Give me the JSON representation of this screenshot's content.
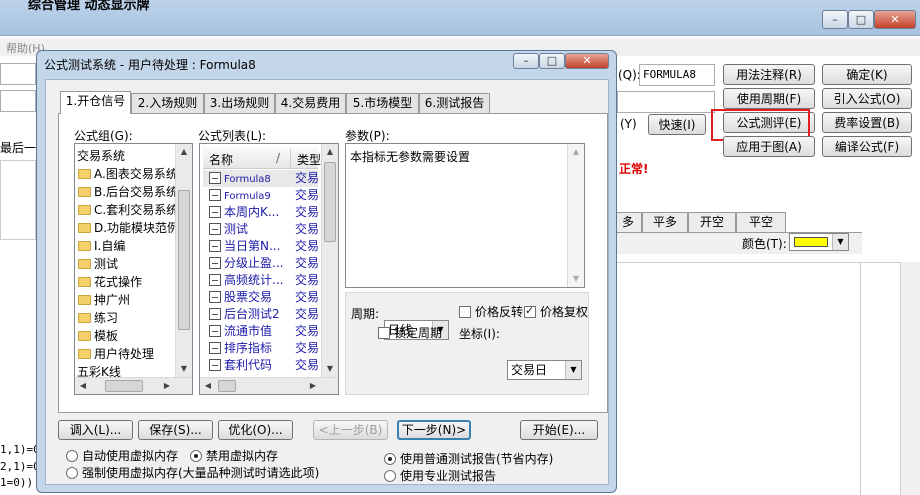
{
  "background": {
    "title": "综合管理 动态显示牌",
    "menu": "帮助(H)",
    "window_controls": {
      "minimize": "–",
      "maximize": "□",
      "close": "✕"
    },
    "formula_name_label": "(Q):",
    "formula_name_value": "FORMULA8",
    "buttons": {
      "usage_notes": "用法注释(R)",
      "confirm": "确定(K)",
      "usage_period": "使用周期(F)",
      "import_formula": "引入公式(O)",
      "quick": "快速(I)",
      "formula_test": "公式测评(E)",
      "fee_setting": "费率设置(B)",
      "apply_to_chart": "应用于图(A)",
      "edit_formula": "编译公式(F)"
    },
    "y_label": "(Y)",
    "status_text": "正常!",
    "left_text": "最后一根",
    "bottom_code": [
      "1,1)=0",
      "2,1)=0",
      "1=0))"
    ],
    "signal_tabs": [
      "多",
      "平多",
      "开空",
      "平空"
    ],
    "color_label": "颜色(T):",
    "color_value": "#ffff00"
  },
  "dialog": {
    "title": "公式测试系统 - 用户待处理 : Formula8",
    "tabs": [
      "1.开仓信号",
      "2.入场规则",
      "3.出场规则",
      "4.交易费用",
      "5.市场模型",
      "6.测试报告"
    ],
    "group_label": "公式组(G):",
    "groups": [
      "交易系统",
      "A.图表交易系统",
      "B.后台交易系统",
      "C.套利交易系统",
      "D.功能模块范例",
      "I.自编",
      "测试",
      "花式操作",
      "抻广州",
      "练习",
      "模板",
      "用户待处理",
      "五彩K线"
    ],
    "list_label": "公式列表(L):",
    "list_columns": [
      "名称",
      "/",
      "类型"
    ],
    "formulas": [
      {
        "name": "Formula8",
        "type": "交易"
      },
      {
        "name": "Formula9",
        "type": "交易"
      },
      {
        "name": "本周内K...",
        "type": "交易"
      },
      {
        "name": "测试",
        "type": "交易"
      },
      {
        "name": "当日第N...",
        "type": "交易"
      },
      {
        "name": "分级止盈...",
        "type": "交易"
      },
      {
        "name": "高频统计...",
        "type": "交易"
      },
      {
        "name": "股票交易",
        "type": "交易"
      },
      {
        "name": "后台测试2",
        "type": "交易"
      },
      {
        "name": "流通市值",
        "type": "交易"
      },
      {
        "name": "排序指标",
        "type": "交易"
      },
      {
        "name": "套利代码",
        "type": "交易"
      }
    ],
    "params_label": "参数(P):",
    "params_text": "本指标无参数需要设置",
    "period_label": "周期:",
    "period_value": "日线",
    "lock_period": "锁定周期",
    "price_invert": "价格反转",
    "price_restore": "价格复权",
    "axis_label": "坐标(I):",
    "axis_value": "交易日",
    "buttons": {
      "load": "调入(L)...",
      "save": "保存(S)...",
      "optimize": "优化(O)...",
      "prev": "<上一步(B)",
      "next": "下一步(N)>",
      "start": "开始(E)..."
    },
    "memory_options": [
      "自动使用虚拟内存",
      "禁用虚拟内存",
      "强制使用虚拟内存(大量品种测试时请选此项)"
    ],
    "report_options": [
      "使用普通测试报告(节省内存)",
      "使用专业测试报告"
    ]
  }
}
